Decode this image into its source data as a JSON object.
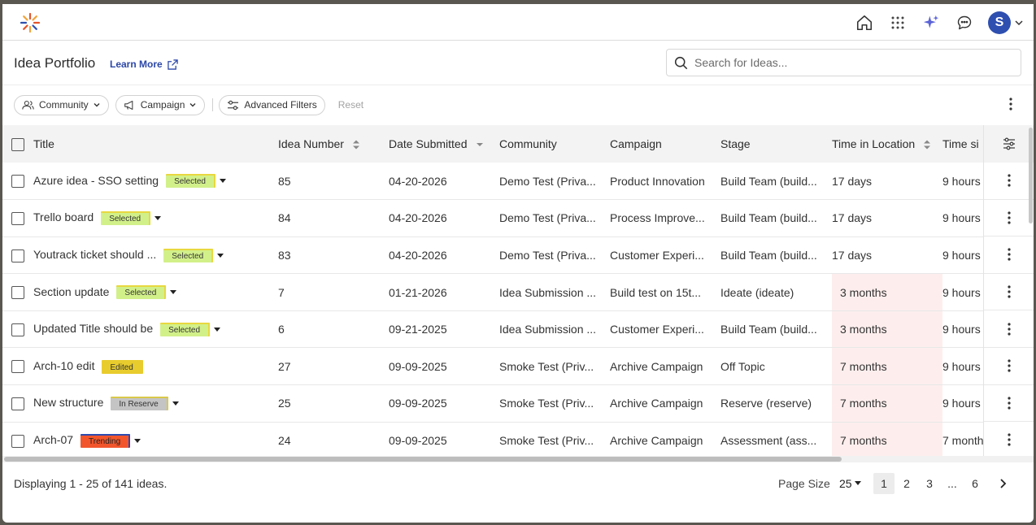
{
  "header": {
    "page_title": "Idea Portfolio",
    "learn_more": "Learn More",
    "search_placeholder": "Search for Ideas...",
    "avatar_initial": "S"
  },
  "filters": {
    "community": "Community",
    "campaign": "Campaign",
    "advanced": "Advanced Filters",
    "reset": "Reset"
  },
  "table": {
    "columns": [
      "Title",
      "Idea Number",
      "Date Submitted",
      "Community",
      "Campaign",
      "Stage",
      "Time in Location",
      "Time si"
    ],
    "rows": [
      {
        "title": "Azure idea - SSO setting",
        "badge": "Selected",
        "number": "85",
        "date": "04-20-2026",
        "community": "Demo Test (Priva...",
        "campaign": "Product Innovation",
        "stage": "Build Team (build...",
        "til": "17 days",
        "time": "9 hours"
      },
      {
        "title": "Trello board",
        "badge": "Selected",
        "number": "84",
        "date": "04-20-2026",
        "community": "Demo Test (Priva...",
        "campaign": "Process Improve...",
        "stage": "Build Team (build...",
        "til": "17 days",
        "time": "9 hours"
      },
      {
        "title": "Youtrack ticket should ...",
        "badge": "Selected",
        "number": "83",
        "date": "04-20-2026",
        "community": "Demo Test (Priva...",
        "campaign": "Customer Experi...",
        "stage": "Build Team (build...",
        "til": "17 days",
        "time": "9 hours"
      },
      {
        "title": "Section update",
        "badge": "Selected",
        "number": "7",
        "date": "01-21-2026",
        "community": "Idea Submission ...",
        "campaign": "Build test on 15t...",
        "stage": "Ideate (ideate)",
        "til": "3 months",
        "time": "9 hours"
      },
      {
        "title": "Updated Title should be",
        "badge": "Selected",
        "number": "6",
        "date": "09-21-2025",
        "community": "Idea Submission ...",
        "campaign": "Customer Experi...",
        "stage": "Build Team (build...",
        "til": "3 months",
        "time": "9 hours"
      },
      {
        "title": "Arch-10 edit",
        "badge": "Edited",
        "number": "27",
        "date": "09-09-2025",
        "community": "Smoke Test (Priv...",
        "campaign": "Archive Campaign",
        "stage": "Off Topic",
        "til": "7 months",
        "time": "9 hours"
      },
      {
        "title": "New structure",
        "badge": "In Reserve",
        "number": "25",
        "date": "09-09-2025",
        "community": "Smoke Test (Priv...",
        "campaign": "Archive Campaign",
        "stage": "Reserve (reserve)",
        "til": "7 months",
        "time": "9 hours"
      },
      {
        "title": "Arch-07",
        "badge": "Trending",
        "number": "24",
        "date": "09-09-2025",
        "community": "Smoke Test (Priv...",
        "campaign": "Archive Campaign",
        "stage": "Assessment (ass...",
        "til": "7 months",
        "time": "7 month"
      }
    ]
  },
  "badge_colors": {
    "Selected": {
      "bg": "#d2f08a",
      "border": "#e8d840",
      "fg": "#333333"
    },
    "Edited": {
      "bg": "#e8cc2e",
      "border": "#e8cc2e",
      "fg": "#333333"
    },
    "In Reserve": {
      "bg": "#c4c4c4",
      "border": "#d9c84a",
      "fg": "#333333"
    },
    "Trending": {
      "bg": "#f2552c",
      "border": "#2d4ab0",
      "fg": "#222222"
    }
  },
  "footer": {
    "displaying": "Displaying 1 - 25 of 141 ideas.",
    "page_size_label": "Page Size",
    "page_size": "25",
    "pages": [
      "1",
      "2",
      "3",
      "...",
      "6"
    ],
    "current_page": "1"
  },
  "colors": {
    "accent": "#2c47a8",
    "avatar": "#2e4fb0",
    "time_in_location_highlight": "#fdeeed"
  }
}
